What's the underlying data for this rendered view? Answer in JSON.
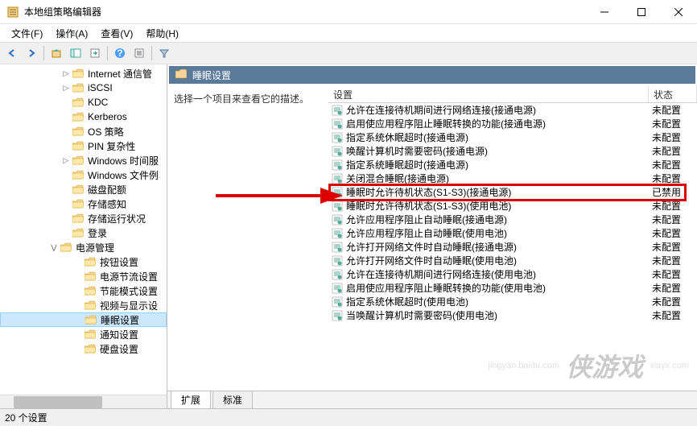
{
  "window": {
    "title": "本地组策略编辑器"
  },
  "menu": {
    "file": "文件(F)",
    "action": "操作(A)",
    "view": "查看(V)",
    "help": "帮助(H)"
  },
  "tree": {
    "items": [
      {
        "label": "Internet 通信管",
        "indent": 75,
        "expander": "▷"
      },
      {
        "label": "iSCSI",
        "indent": 75,
        "expander": "▷"
      },
      {
        "label": "KDC",
        "indent": 75,
        "expander": ""
      },
      {
        "label": "Kerberos",
        "indent": 75,
        "expander": ""
      },
      {
        "label": "OS 策略",
        "indent": 75,
        "expander": ""
      },
      {
        "label": "PIN 复杂性",
        "indent": 75,
        "expander": ""
      },
      {
        "label": "Windows 时间服",
        "indent": 75,
        "expander": "▷"
      },
      {
        "label": "Windows 文件例",
        "indent": 75,
        "expander": ""
      },
      {
        "label": "磁盘配额",
        "indent": 75,
        "expander": ""
      },
      {
        "label": "存储感知",
        "indent": 75,
        "expander": ""
      },
      {
        "label": "存储运行状况",
        "indent": 75,
        "expander": ""
      },
      {
        "label": "登录",
        "indent": 75,
        "expander": ""
      },
      {
        "label": "电源管理",
        "indent": 60,
        "expander": "⋁",
        "bold": false
      },
      {
        "label": "按钮设置",
        "indent": 90,
        "expander": ""
      },
      {
        "label": "电源节流设置",
        "indent": 90,
        "expander": ""
      },
      {
        "label": "节能模式设置",
        "indent": 90,
        "expander": ""
      },
      {
        "label": "视频与显示设",
        "indent": 90,
        "expander": ""
      },
      {
        "label": "睡眠设置",
        "indent": 90,
        "expander": "",
        "selected": true
      },
      {
        "label": "通知设置",
        "indent": 90,
        "expander": ""
      },
      {
        "label": "硬盘设置",
        "indent": 90,
        "expander": ""
      }
    ]
  },
  "path": {
    "label": "睡眠设置"
  },
  "description": "选择一个项目来查看它的描述。",
  "columns": {
    "setting": "设置",
    "state": "状态"
  },
  "settings": [
    {
      "label": "允许在连接待机期间进行网络连接(接通电源)",
      "state": "未配置"
    },
    {
      "label": "启用使应用程序阻止睡眠转换的功能(接通电源)",
      "state": "未配置"
    },
    {
      "label": "指定系统休眠超时(接通电源)",
      "state": "未配置"
    },
    {
      "label": "唤醒计算机时需要密码(接通电源)",
      "state": "未配置"
    },
    {
      "label": "指定系统睡眠超时(接通电源)",
      "state": "未配置"
    },
    {
      "label": "关闭混合睡眠(接通电源)",
      "state": "未配置"
    },
    {
      "label": "睡眠时允许待机状态(S1-S3)(接通电源)",
      "state": "已禁用",
      "highlighted": true
    },
    {
      "label": "睡眠时允许待机状态(S1-S3)(使用电池)",
      "state": "未配置"
    },
    {
      "label": "允许应用程序阻止自动睡眠(接通电源)",
      "state": "未配置"
    },
    {
      "label": "允许应用程序阻止自动睡眠(使用电池)",
      "state": "未配置"
    },
    {
      "label": "允许打开网络文件时自动睡眠(接通电源)",
      "state": "未配置"
    },
    {
      "label": "允许打开网络文件时自动睡眠(使用电池)",
      "state": "未配置"
    },
    {
      "label": "允许在连接待机期间进行网络连接(使用电池)",
      "state": "未配置"
    },
    {
      "label": "启用使应用程序阻止睡眠转换的功能(使用电池)",
      "state": "未配置"
    },
    {
      "label": "指定系统休眠超时(使用电池)",
      "state": "未配置"
    },
    {
      "label": "当唤醒计算机时需要密码(使用电池)",
      "state": "未配置"
    }
  ],
  "tabs": {
    "extended": "扩展",
    "standard": "标准"
  },
  "statusbar": {
    "count": "20 个设置"
  },
  "watermark": {
    "logo": "侠游戏",
    "url": "xiayx.com",
    "id": "jingyan.baidu.com"
  }
}
